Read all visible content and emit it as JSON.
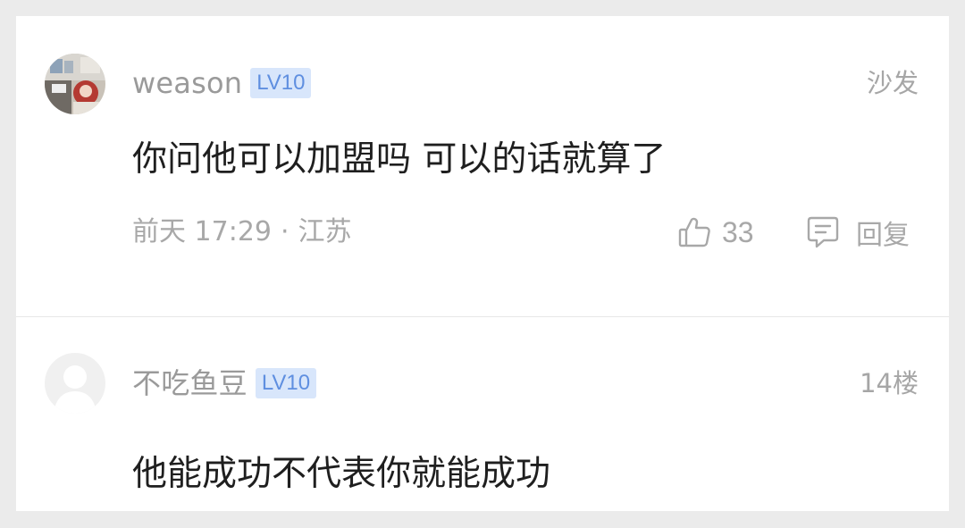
{
  "comments": [
    {
      "username": "weason",
      "level": "LV10",
      "floor": "沙发",
      "content": "你问他可以加盟吗 可以的话就算了",
      "time": "前天 17:29",
      "separator": "·",
      "location": "江苏",
      "likes": "33",
      "reply_label": "回复",
      "avatar_icon": "photo-avatar"
    },
    {
      "username": "不吃鱼豆",
      "level": "LV10",
      "floor": "14楼",
      "content": "他能成功不代表你就能成功",
      "avatar_icon": "default-avatar"
    }
  ],
  "colors": {
    "background": "#ebebeb",
    "card": "#ffffff",
    "badge_bg": "#d8e6fb",
    "badge_text": "#5f8fe0",
    "muted_text": "#a8a8a8",
    "body_text": "#1f1f1f"
  }
}
